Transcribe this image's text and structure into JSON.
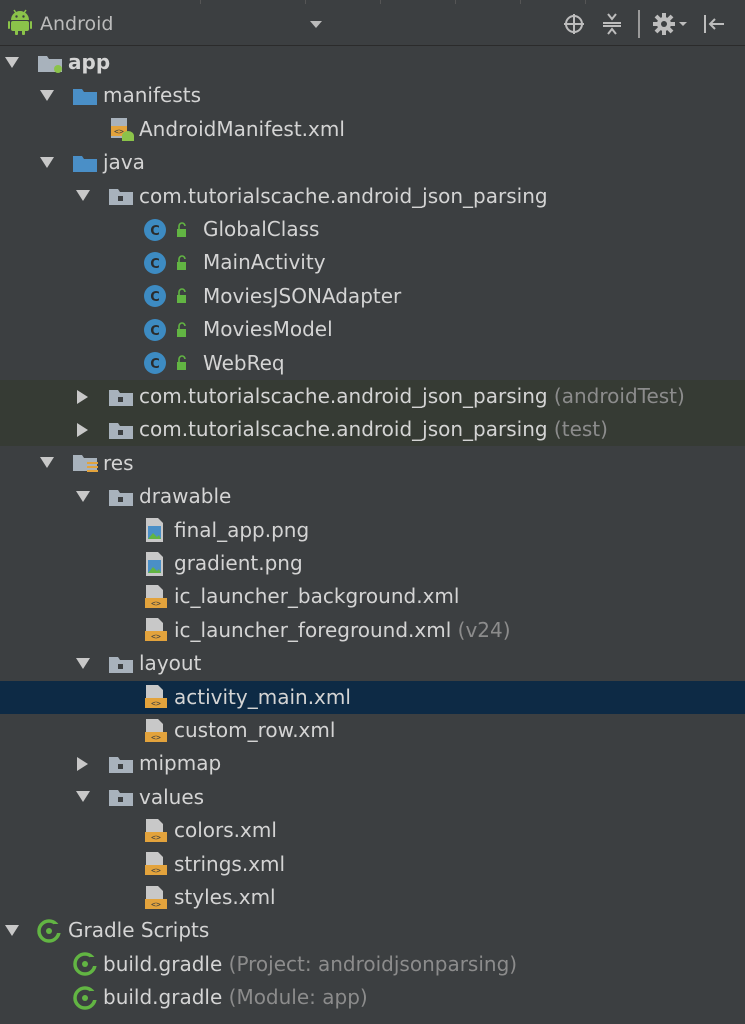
{
  "toolbar": {
    "view_mode": "Android",
    "icons": [
      "android-icon",
      "dropdown-caret",
      "locate-icon",
      "collapse-icon",
      "gear-icon",
      "hide-panel-icon"
    ]
  },
  "tree": [
    {
      "label": "app",
      "hint": "",
      "icon": "module-folder",
      "expanded": true,
      "indent": 0
    },
    {
      "label": "manifests",
      "hint": "",
      "icon": "folder",
      "expanded": true,
      "indent": 1
    },
    {
      "label": "AndroidManifest.xml",
      "hint": "",
      "icon": "manifest-file",
      "expanded": null,
      "indent": 2
    },
    {
      "label": "java",
      "hint": "",
      "icon": "folder",
      "expanded": true,
      "indent": 1
    },
    {
      "label": "com.tutorialscache.android_json_parsing",
      "hint": "",
      "icon": "package",
      "expanded": true,
      "indent": 2
    },
    {
      "label": "GlobalClass",
      "hint": "",
      "icon": "class",
      "expanded": null,
      "indent": 3
    },
    {
      "label": "MainActivity",
      "hint": "",
      "icon": "class",
      "expanded": null,
      "indent": 3
    },
    {
      "label": "MoviesJSONAdapter",
      "hint": "",
      "icon": "class",
      "expanded": null,
      "indent": 3
    },
    {
      "label": "MoviesModel",
      "hint": "",
      "icon": "class",
      "expanded": null,
      "indent": 3
    },
    {
      "label": "WebReq",
      "hint": "",
      "icon": "class",
      "expanded": null,
      "indent": 3
    },
    {
      "label": "com.tutorialscache.android_json_parsing",
      "hint": "(androidTest)",
      "icon": "package",
      "expanded": false,
      "indent": 2
    },
    {
      "label": "com.tutorialscache.android_json_parsing",
      "hint": "(test)",
      "icon": "package",
      "expanded": false,
      "indent": 2
    },
    {
      "label": "res",
      "hint": "",
      "icon": "res-folder",
      "expanded": true,
      "indent": 1
    },
    {
      "label": "drawable",
      "hint": "",
      "icon": "package",
      "expanded": true,
      "indent": 2
    },
    {
      "label": "final_app.png",
      "hint": "",
      "icon": "image-file",
      "expanded": null,
      "indent": 3
    },
    {
      "label": "gradient.png",
      "hint": "",
      "icon": "image-file",
      "expanded": null,
      "indent": 3
    },
    {
      "label": "ic_launcher_background.xml",
      "hint": "",
      "icon": "xml-file",
      "expanded": null,
      "indent": 3
    },
    {
      "label": "ic_launcher_foreground.xml",
      "hint": "(v24)",
      "icon": "xml-file",
      "expanded": null,
      "indent": 3
    },
    {
      "label": "layout",
      "hint": "",
      "icon": "package",
      "expanded": true,
      "indent": 2
    },
    {
      "label": "activity_main.xml",
      "hint": "",
      "icon": "xml-file",
      "expanded": null,
      "indent": 3
    },
    {
      "label": "custom_row.xml",
      "hint": "",
      "icon": "xml-file",
      "expanded": null,
      "indent": 3
    },
    {
      "label": "mipmap",
      "hint": "",
      "icon": "package",
      "expanded": false,
      "indent": 2
    },
    {
      "label": "values",
      "hint": "",
      "icon": "package",
      "expanded": true,
      "indent": 2
    },
    {
      "label": "colors.xml",
      "hint": "",
      "icon": "xml-file",
      "expanded": null,
      "indent": 3
    },
    {
      "label": "strings.xml",
      "hint": "",
      "icon": "xml-file",
      "expanded": null,
      "indent": 3
    },
    {
      "label": "styles.xml",
      "hint": "",
      "icon": "xml-file",
      "expanded": null,
      "indent": 3
    },
    {
      "label": "Gradle Scripts",
      "hint": "",
      "icon": "gradle",
      "expanded": true,
      "indent": 0
    },
    {
      "label": "build.gradle",
      "hint": "(Project: androidjsonparsing)",
      "icon": "gradle",
      "expanded": null,
      "indent": 1
    },
    {
      "label": "build.gradle",
      "hint": "(Module: app)",
      "icon": "gradle",
      "expanded": null,
      "indent": 1
    }
  ],
  "selected_label": "activity_main.xml",
  "colors": {
    "background": "#3c3f41",
    "selection": "#0d2a45",
    "test_highlight": "#363b34",
    "folder_blue": "#4a8fc7",
    "class_blue": "#3d8bc2",
    "xml_orange": "#e3a33c",
    "gradle_green": "#62b543",
    "hint_gray": "#8c8c8c"
  }
}
